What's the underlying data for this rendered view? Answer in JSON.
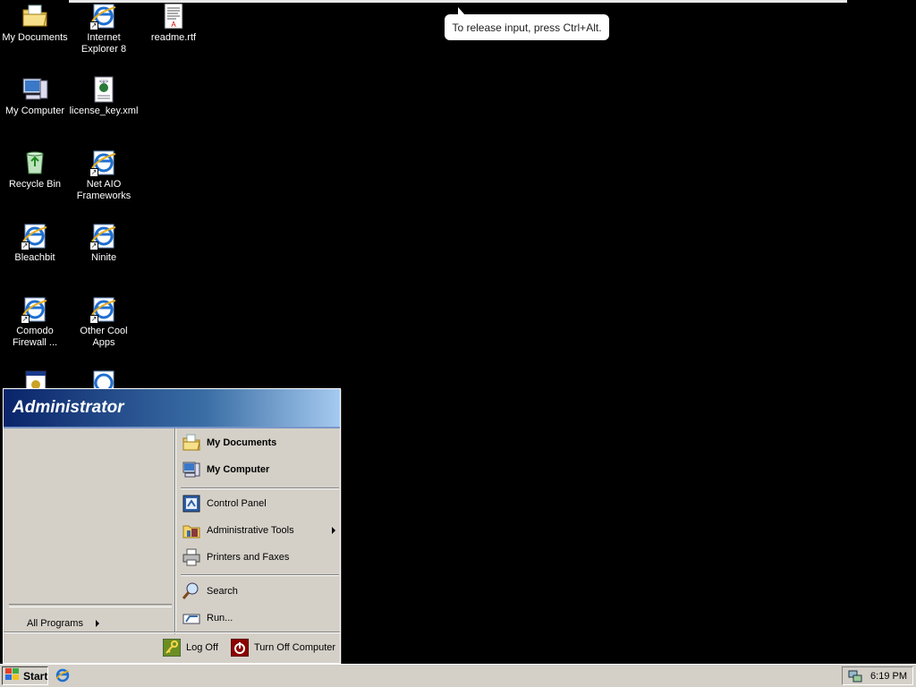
{
  "tooltip": {
    "text": "To release input, press Ctrl+Alt."
  },
  "desktop": {
    "icons": [
      {
        "label": "My Documents",
        "icon": "folder-documents-icon"
      },
      {
        "label": "Internet Explorer 8",
        "icon": "internet-explorer-icon"
      },
      {
        "label": "readme.rtf",
        "icon": "rtf-document-icon"
      },
      {
        "label": "My Computer",
        "icon": "computer-icon"
      },
      {
        "label": "license_key.xml",
        "icon": "xml-document-icon"
      },
      {
        "label": "Recycle Bin",
        "icon": "recycle-bin-icon"
      },
      {
        "label": "Net AIO Frameworks",
        "icon": "ie-shortcut-icon"
      },
      {
        "label": "Bleachbit",
        "icon": "ie-shortcut-icon"
      },
      {
        "label": "Ninite",
        "icon": "ie-shortcut-icon"
      },
      {
        "label": "Comodo Firewall ...",
        "icon": "ie-shortcut-icon"
      },
      {
        "label": "Other Cool Apps",
        "icon": "ie-shortcut-icon"
      }
    ]
  },
  "start_menu": {
    "user": "Administrator",
    "all_programs": "All Programs",
    "right_items": {
      "my_documents": "My Documents",
      "my_computer": "My Computer",
      "control_panel": "Control Panel",
      "admin_tools": "Administrative Tools",
      "printers": "Printers and Faxes",
      "search": "Search",
      "run": "Run..."
    },
    "log_off": "Log Off",
    "turn_off": "Turn Off Computer"
  },
  "taskbar": {
    "start_label": "Start",
    "clock": "6:19 PM"
  },
  "colors": {
    "desktop": "#000000",
    "face": "#d4d0c8",
    "header_dark": "#0a246a",
    "header_light": "#a6caf0"
  }
}
